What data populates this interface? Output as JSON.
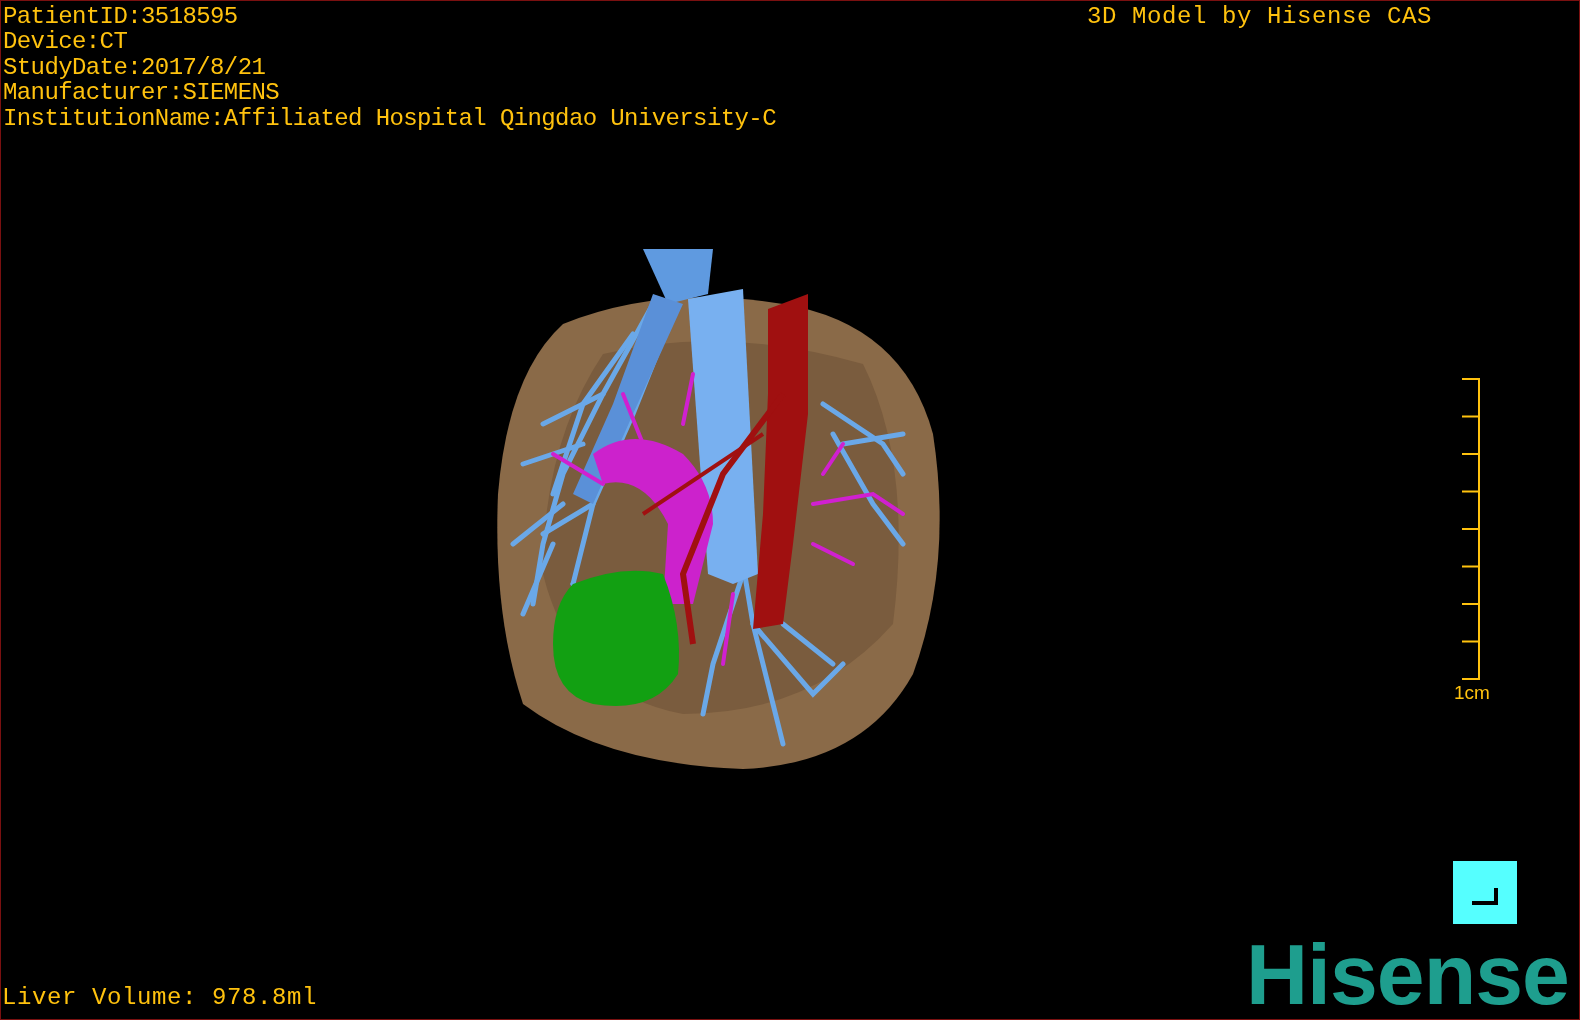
{
  "info_lines": [
    "PatientID:3518595",
    "Device:CT",
    "StudyDate:2017/8/21",
    "Manufacturer:SIEMENS",
    "InstitutionName:Affiliated Hospital Qingdao University-C"
  ],
  "title": "3D Model by Hisense CAS",
  "scale_bar": {
    "label": "1cm"
  },
  "liver_volume": "Liver Volume: 978.8ml",
  "logo": "Hisense"
}
